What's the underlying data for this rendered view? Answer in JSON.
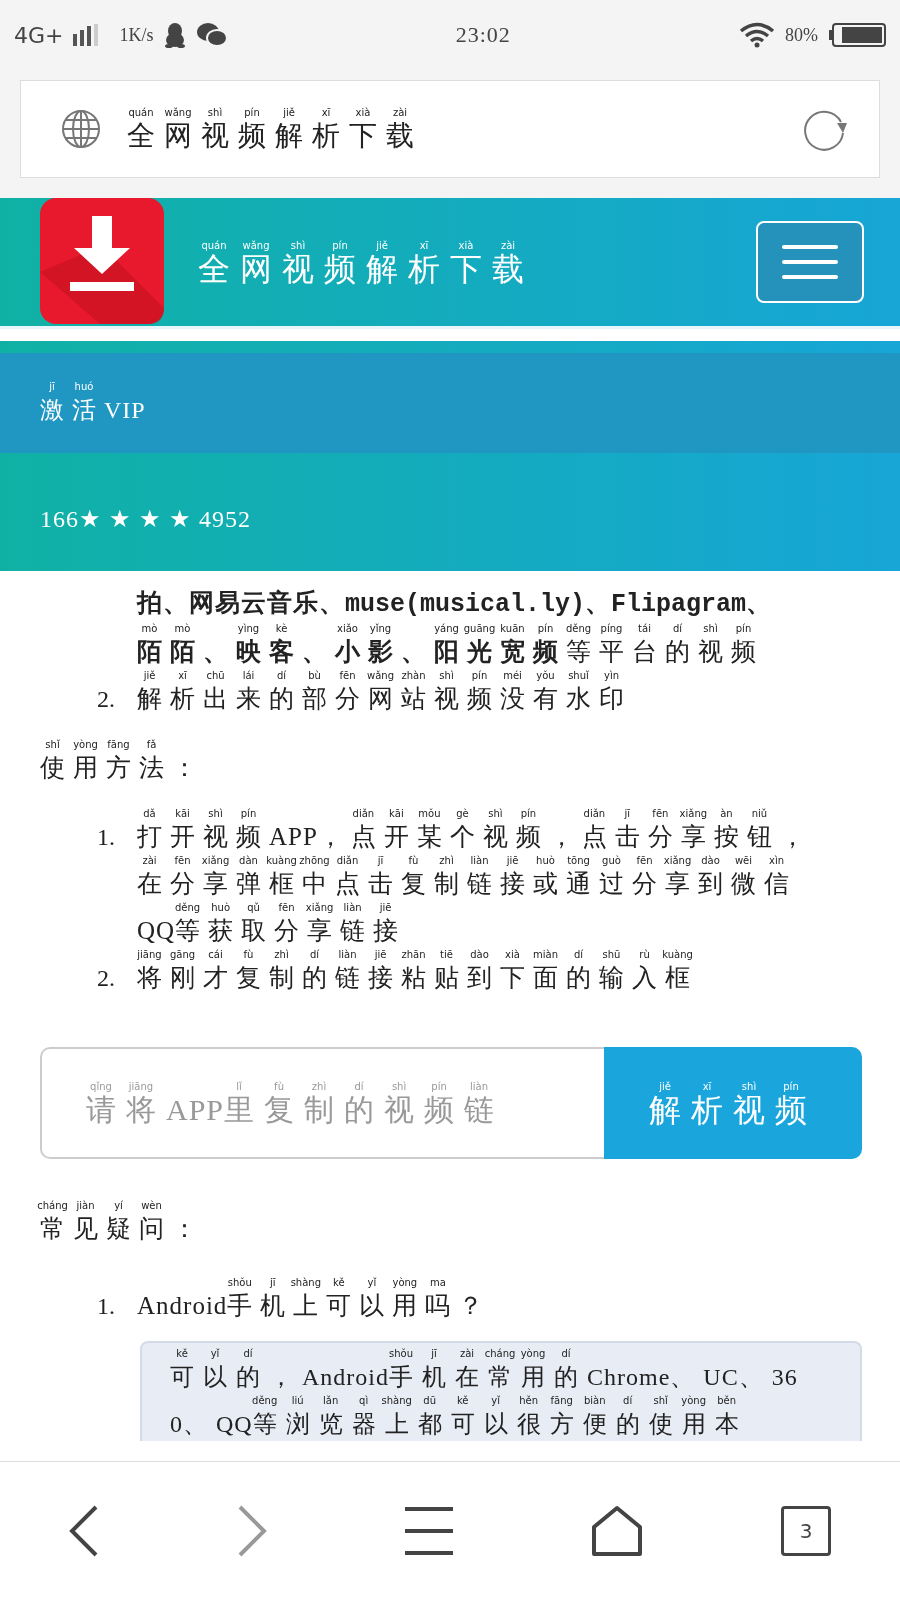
{
  "status_bar": {
    "network": "4G+",
    "speed": "1K/s",
    "time": "23:02",
    "battery": "80%"
  },
  "address_bar": {
    "title": {
      "text": "全网视频解析下载",
      "pinyin": "quán wǎng shì pín jiě xī xià zài"
    }
  },
  "site_header": {
    "title": {
      "text": "全网视频解析下载",
      "pinyin": "quán wǎng shì pín jiě xī xià zài"
    }
  },
  "menu": [
    {
      "kind": "vip",
      "label": {
        "text": "激活VIP",
        "pinyin": "jī huó"
      }
    },
    {
      "kind": "account",
      "label": {
        "text": "166★★★★4952"
      }
    }
  ],
  "intro_list": [
    {
      "lines": [
        {
          "text": "拍、网易云音乐、muse(musical.ly)、Flipagram、",
          "bold": true
        },
        {
          "text": "**陌陌、映客、小影、阳光宽频**等平台的视频",
          "pinyin": "mò mò yìng kè xiǎo yǐng yáng guāng kuān pín děng píng tái dí shì pín"
        }
      ]
    },
    {
      "number": "2.",
      "lines": [
        {
          "text": "解析出来的部分网站视频没有水印",
          "pinyin": "jiě xī chū lái dí bù fēn wǎng zhàn shì pín méi yǒu shuǐ yìn"
        }
      ]
    }
  ],
  "usage_heading": {
    "text": "使用方法：",
    "pinyin": "shǐ yòng fāng fǎ"
  },
  "usage_list": [
    {
      "number": "1.",
      "lines": [
        {
          "text": "打开视频APP，点开某个视频，点击分享按钮，",
          "pinyin": "dǎ kāi shì pín diǎn kāi mǒu gè shì pín diǎn jī fēn xiǎng àn niǔ"
        },
        {
          "text": "在分享弹框中点击复制链接或通过分享到微信",
          "pinyin": "zài fēn xiǎng dàn kuàng zhōng diǎn jī fù zhì liàn jiē huò tōng guò fēn xiǎng dào wēi xìn"
        },
        {
          "text": "QQ等获取分享链接",
          "pinyin": "děng huò qǔ fēn xiǎng liàn jiē"
        }
      ]
    },
    {
      "number": "2.",
      "lines": [
        {
          "text": "将刚才复制的链接粘贴到下面的输入框",
          "pinyin": "jiāng gāng cái fù zhì dí liàn jiē zhān tiē dào xià miàn dí shū rù kuàng"
        }
      ]
    }
  ],
  "link_form": {
    "placeholder": {
      "text": "请将APP里复制的视频链",
      "pinyin": "qǐng jiāng lǐ fù zhì dí shì pín liàn"
    },
    "button": {
      "text": "解析视频",
      "pinyin": "jiě xī shì pín"
    }
  },
  "faq_heading": {
    "text": "常见疑问：",
    "pinyin": "cháng jiàn yí wèn"
  },
  "faq": [
    {
      "number": "1.",
      "question": {
        "text": "Android手机上可以用吗？",
        "pinyin": "shǒu jī shàng kě yǐ yòng ma"
      },
      "answer_lines": [
        {
          "text": "可以的，Android手机在常用的Chrome、UC、36",
          "pinyin": "kě yǐ dí shǒu jī zài cháng yòng dí"
        },
        {
          "text": "0、QQ等浏览器上都可以很方便的使用本",
          "pinyin": "děng liú lǎn qì shàng dū kě yǐ hěn fāng biàn dí shǐ yòng běn"
        }
      ]
    }
  ],
  "bottom_nav": [
    {
      "kind": "back",
      "disabled": false
    },
    {
      "kind": "forward",
      "disabled": true
    },
    {
      "kind": "menu",
      "disabled": false
    },
    {
      "kind": "home",
      "disabled": false
    },
    {
      "kind": "tabs",
      "count": "3",
      "disabled": false
    }
  ]
}
